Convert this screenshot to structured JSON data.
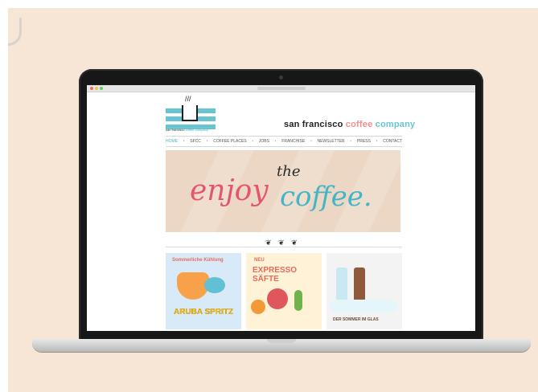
{
  "site": {
    "logo_text_black": "san francisco",
    "logo_text_blue": "coffee company",
    "brand_main": "san francisco",
    "brand_coffee": "coffee",
    "brand_company": "company",
    "nav": [
      {
        "label": "HOME"
      },
      {
        "label": "SFCC"
      },
      {
        "label": "COFFEE PLACES"
      },
      {
        "label": "JOBS"
      },
      {
        "label": "FRANCHISE"
      },
      {
        "label": "NEWSLETTER"
      },
      {
        "label": "PRESS"
      },
      {
        "label": "CONTACT"
      }
    ],
    "hero": {
      "enjoy": "enjoy",
      "the": "the",
      "coffee": "coffee."
    },
    "ornament": "❦ ❦ ❦",
    "tiles": [
      {
        "top": "Sommerliche Kühlung",
        "big": "ARUBA SPRITZ"
      },
      {
        "top": "NEU",
        "big": "EXPRESSO SÄFTE"
      },
      {
        "top": "",
        "big": "",
        "tagline": "DER SOMMER IM GLAS"
      }
    ]
  },
  "colors": {
    "background": "#f7e6d5",
    "accent_blue": "#69c4d1",
    "accent_pink": "#e4576b",
    "text_dark": "#222222"
  }
}
